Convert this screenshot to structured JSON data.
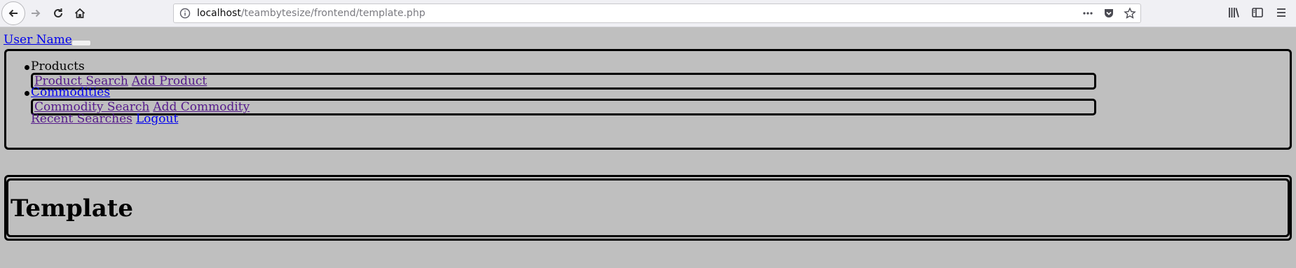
{
  "browser": {
    "url_host": "localhost",
    "url_path": "/teambytesize/frontend/template.php"
  },
  "header": {
    "user_name": "User Name"
  },
  "nav": {
    "products_label": "Products",
    "product_search": "Product Search",
    "add_product": "Add Product",
    "commodities_label": "Commodities",
    "commodity_search": "Commodity Search",
    "add_commodity": "Add Commodity",
    "recent_searches": "Recent Searches",
    "logout": "Logout"
  },
  "main": {
    "title": "Template"
  },
  "colors": {
    "page_background": "#bfbfbf",
    "link": "#0000ee",
    "visited_link": "#551a8b"
  }
}
